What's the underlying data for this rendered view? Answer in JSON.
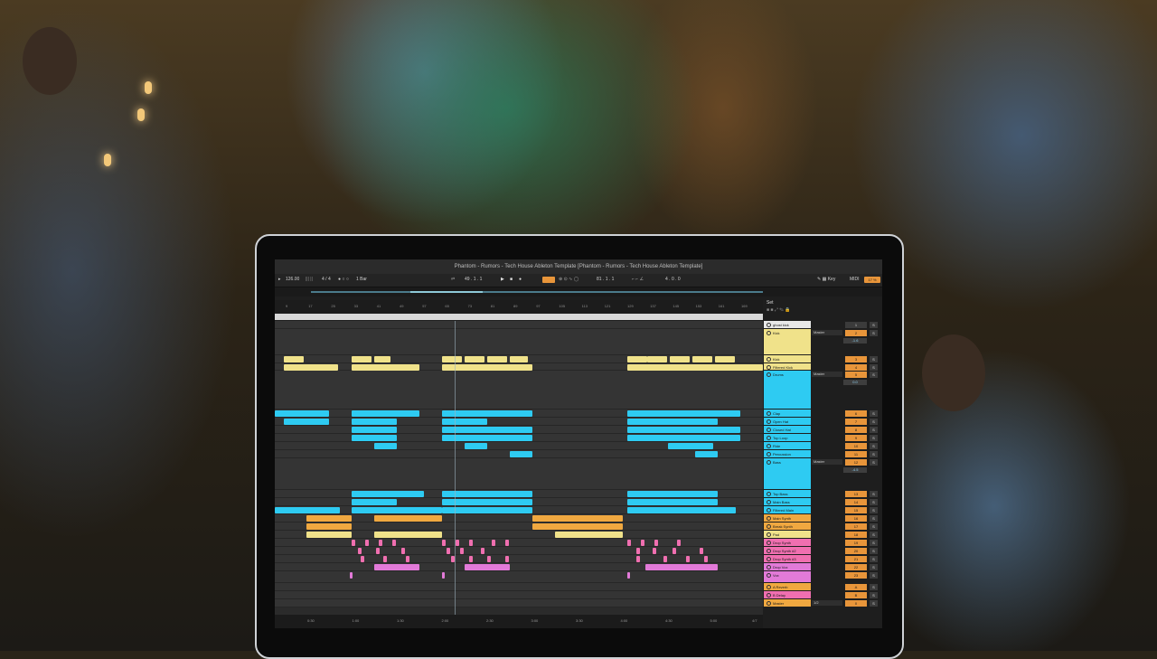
{
  "window": {
    "title": "Phantom - Rumors - Tech House Ableton Template  [Phantom - Rumors - Tech House Ableton Template]"
  },
  "transport": {
    "tempo": "126.00",
    "signature": "4 / 4",
    "quantize": "1 Bar",
    "position": "49 . 1 . 1",
    "loop_start": "81 . 1 . 1",
    "loop_length": "4 . 0 . 0",
    "key_label": "Key",
    "midi_label": "MIDI",
    "cpu": "17 %"
  },
  "ruler": {
    "bars": [
      "9",
      "17",
      "25",
      "33",
      "41",
      "49",
      "57",
      "65",
      "73",
      "81",
      "89",
      "97",
      "105",
      "113",
      "121",
      "129",
      "137",
      "145",
      "153",
      "161",
      "169"
    ]
  },
  "timeline": {
    "times": [
      "0:30",
      "1:00",
      "1:30",
      "2:00",
      "2:30",
      "3:00",
      "3:30",
      "4:00",
      "4:30",
      "5:00"
    ]
  },
  "set_label": "Set",
  "fraction": "4/7",
  "tracks": [
    {
      "name": "ghost kick",
      "color": "#e8e8e8",
      "number": "1",
      "solo": "S"
    },
    {
      "name": "Kick",
      "color": "#f0e28a",
      "io": "Master",
      "number": "2",
      "volume": "-1.6",
      "solo": "S"
    },
    {
      "name": "Kick",
      "color": "#f0e28a",
      "number": "3",
      "solo": "S"
    },
    {
      "name": "Filtered Kick",
      "color": "#f0e28a",
      "number": "4",
      "solo": "S"
    },
    {
      "name": "Drums",
      "color": "#2ecbf2",
      "io": "Master",
      "number": "5",
      "volume": "0.0",
      "solo": "S"
    },
    {
      "name": "Clap",
      "color": "#2ecbf2",
      "number": "6",
      "solo": "S"
    },
    {
      "name": "Open Hat",
      "color": "#2ecbf2",
      "number": "7",
      "solo": "S"
    },
    {
      "name": "Closed Hat",
      "color": "#2ecbf2",
      "number": "8",
      "solo": "S"
    },
    {
      "name": "Top Loop",
      "color": "#2ecbf2",
      "number": "9",
      "solo": "S"
    },
    {
      "name": "Ride",
      "color": "#2ecbf2",
      "number": "10",
      "solo": "S"
    },
    {
      "name": "Percussion",
      "color": "#2ecbf2",
      "number": "11",
      "solo": "S"
    },
    {
      "name": "Bass",
      "color": "#2ecbf2",
      "io": "Master",
      "number": "12",
      "volume": "-4.5",
      "solo": "S"
    },
    {
      "name": "Top Bass",
      "color": "#2ecbf2",
      "number": "13",
      "solo": "S"
    },
    {
      "name": "Main Bass",
      "color": "#2ecbf2",
      "number": "14",
      "solo": "S"
    },
    {
      "name": "Filtered Main",
      "color": "#2ecbf2",
      "number": "15",
      "solo": "S"
    },
    {
      "name": "Main Synth",
      "color": "#f0a840",
      "number": "16",
      "solo": "S"
    },
    {
      "name": "Break Synth",
      "color": "#f0a840",
      "number": "17",
      "solo": "S"
    },
    {
      "name": "Pad",
      "color": "#f0e28a",
      "number": "18",
      "solo": "S"
    },
    {
      "name": "Drop Synth",
      "color": "#f06fb0",
      "number": "19",
      "solo": "S"
    },
    {
      "name": "Drop Synth #2",
      "color": "#f06fb0",
      "number": "20",
      "solo": "S"
    },
    {
      "name": "Drop Synth #3",
      "color": "#f06fb0",
      "number": "21",
      "solo": "S"
    },
    {
      "name": "Drop Vox",
      "color": "#e27ad8",
      "number": "22",
      "solo": "S"
    },
    {
      "name": "Vox",
      "color": "#e27ad8",
      "number": "23",
      "solo": "S"
    },
    {
      "name": "A Reverb",
      "color": "#f0a840",
      "number": "A",
      "solo": "S"
    },
    {
      "name": "B Delay",
      "color": "#f06fb0",
      "number": "B",
      "solo": "S"
    },
    {
      "name": "Master",
      "color": "#f0a840",
      "io": "1/2",
      "number": "0",
      "solo": "S"
    }
  ],
  "clip_labels": {
    "phat": "Phat",
    "phat_short": "Pha"
  }
}
